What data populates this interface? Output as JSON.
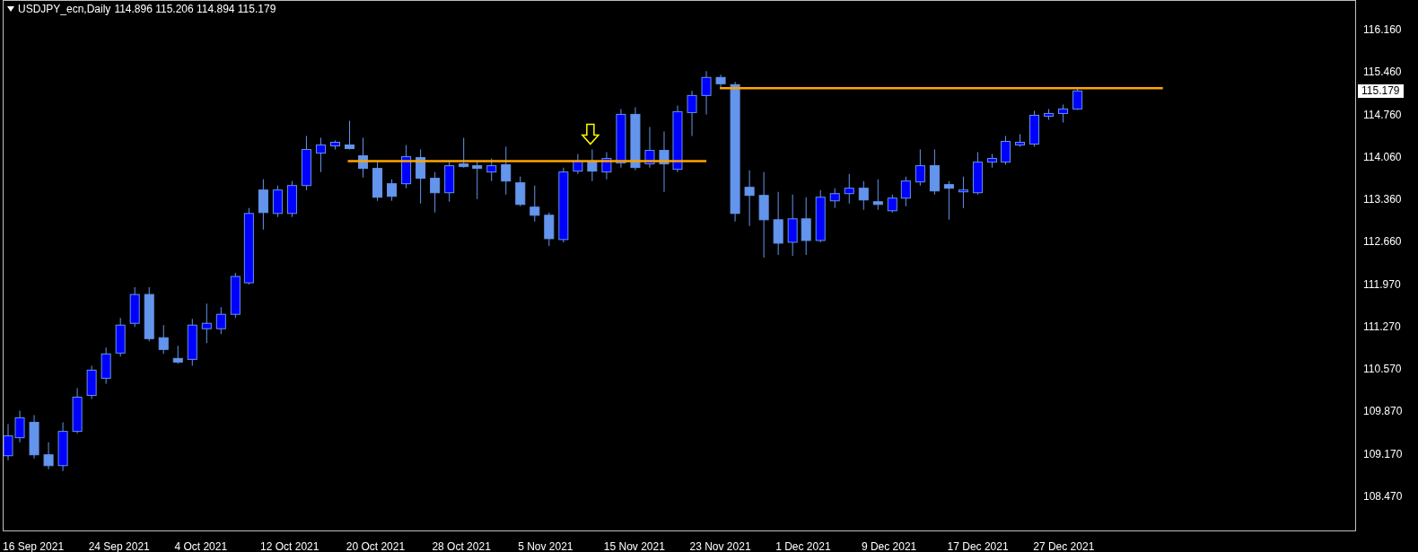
{
  "chart": {
    "symbol": "USDJPY_ecn,Daily",
    "quote": "114.896 115.206 114.894 115.179"
  },
  "price_axis": [
    "116.160",
    "115.460",
    "114.760",
    "114.060",
    "113.360",
    "112.660",
    "111.970",
    "111.270",
    "110.570",
    "109.870",
    "109.170",
    "108.470"
  ],
  "current_price": "115.179",
  "date_axis": [
    "16 Sep 2021",
    "24 Sep 2021",
    "4 Oct 2021",
    "12 Oct 2021",
    "20 Oct 2021",
    "28 Oct 2021",
    "5 Nov 2021",
    "15 Nov 2021",
    "23 Nov 2021",
    "1 Dec 2021",
    "9 Dec 2021",
    "17 Dec 2021",
    "27 Dec 2021"
  ]
}
